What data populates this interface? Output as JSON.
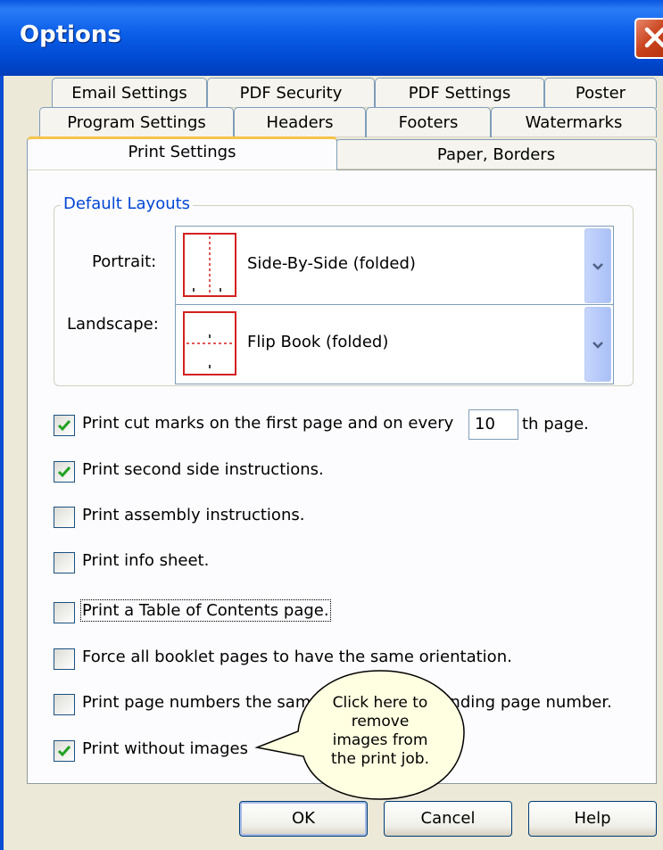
{
  "window": {
    "title": "Options"
  },
  "tabs_row1": [
    "Email Settings",
    "PDF Security",
    "PDF Settings",
    "Poster"
  ],
  "tabs_row2": [
    "Program Settings",
    "Headers",
    "Footers",
    "Watermarks"
  ],
  "tabs_row3": [
    "Print Settings",
    "Paper, Borders"
  ],
  "active_tab": "Print Settings",
  "default_layouts": {
    "group_label": "Default Layouts",
    "portrait": {
      "label": "Portrait:",
      "value": "Side-By-Side (folded)",
      "icon": "side-by-side-layout-icon"
    },
    "landscape": {
      "label": "Landscape:",
      "value": "Flip Book (folded)",
      "icon": "flip-book-layout-icon"
    }
  },
  "cut_marks": {
    "checked": true,
    "label": "Print cut marks on the first page and on every",
    "value": "10",
    "suffix": "th page."
  },
  "options": [
    {
      "label": "Print second side instructions.",
      "checked": true
    },
    {
      "label": "Print assembly instructions.",
      "checked": false
    },
    {
      "label": "Print info sheet.",
      "checked": false
    },
    {
      "label": "Print a Table of Contents page.",
      "checked": false
    },
    {
      "label": "Force all booklet pages to have the same orientation.",
      "checked": false
    },
    {
      "label": "Print page numbers the same as the corresponding page number.",
      "checked": false
    },
    {
      "label": "Print without images",
      "checked": true
    }
  ],
  "callout": {
    "text": "Click here to remove images from the print job."
  },
  "buttons": {
    "ok": "OK",
    "cancel": "Cancel",
    "help": "Help"
  },
  "colors": {
    "title_bar": "#0a56e0",
    "close_button": "#c8431c",
    "group_label": "#0046d5",
    "active_tab_accent": "#f6c44a",
    "callout_fill": "#ffffe1"
  }
}
